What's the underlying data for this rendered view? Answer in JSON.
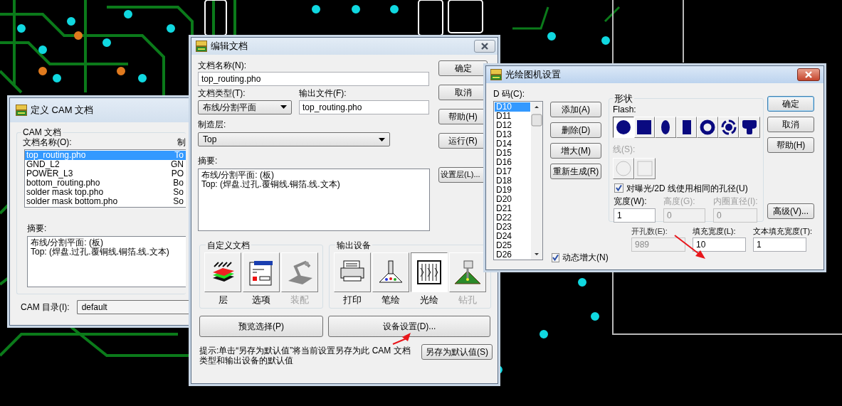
{
  "cam_window": {
    "title": "定义 CAM 文档",
    "group_label": "CAM 文档",
    "list_label": "文档名称(O):",
    "column_2_label": "制",
    "documents": [
      {
        "name": "top_routing.pho",
        "column_2": "To",
        "selected": true
      },
      {
        "name": "GND_L2",
        "column_2": "GN",
        "selected": false
      },
      {
        "name": "POWER_L3",
        "column_2": "PO",
        "selected": false
      },
      {
        "name": "bottom_routing.pho",
        "column_2": "Bo",
        "selected": false
      },
      {
        "name": "solder mask top.pho",
        "column_2": "So",
        "selected": false
      },
      {
        "name": "solder mask bottom.pho",
        "column_2": "So",
        "selected": false
      }
    ],
    "summary_label": "摘要:",
    "summary": [
      "布线/分割平面: (板)",
      "Top: (焊盘.过孔.覆铜线.铜箔.线.文本)"
    ],
    "directory_label": "CAM 目录(I):",
    "directory": "default"
  },
  "edit_window": {
    "title": "编辑文档",
    "name_label": "文档名称(N):",
    "name": "top_routing.pho",
    "type_label": "文档类型(T):",
    "type": "布线/分割平面",
    "output_label": "输出文件(F):",
    "output": "top_routing.pho",
    "layer_label": "制造层:",
    "layer": "Top",
    "summary_label": "摘要:",
    "summary": [
      "布线/分割平面: (板)",
      "Top: (焊盘.过孔.覆铜线.铜箔.线.文本)"
    ],
    "buttons": [
      "确定",
      "取消",
      "帮助(H)",
      "运行(R)",
      "设置层(L)..."
    ],
    "custom_group": "自定义文档",
    "custom_items": [
      {
        "kind": "layers",
        "label": "层",
        "disabled": false
      },
      {
        "kind": "options",
        "label": "选项",
        "disabled": false
      },
      {
        "kind": "assembly",
        "label": "装配",
        "disabled": true
      }
    ],
    "output_group": "输出设备",
    "output_devices": [
      {
        "kind": "print",
        "label": "打印",
        "disabled": false,
        "selected": false
      },
      {
        "kind": "pen",
        "label": "笔绘",
        "disabled": false,
        "selected": false
      },
      {
        "label": "光绘",
        "disabled": false,
        "selected": true
      },
      {
        "kind": "drill",
        "label": "钻孔",
        "disabled": true,
        "selected": false
      }
    ],
    "preview_button": "预览选择(P)",
    "device_button": "设备设置(D)...",
    "hint": "提示:单击“另存为默认值”将当前设置另存为此 CAM 文档类型和输出设备的默认值",
    "save_default_button": "另存为默认值(S)"
  },
  "photo_window": {
    "title": "光绘图机设置",
    "dcode_label": "D 码(C):",
    "dcodes": [
      {
        "code": "D10",
        "selected": true
      },
      {
        "code": "D11",
        "selected": false
      },
      {
        "code": "D12",
        "selected": false
      },
      {
        "code": "D13",
        "selected": false
      },
      {
        "code": "D14",
        "selected": false
      },
      {
        "code": "D15",
        "selected": false
      },
      {
        "code": "D16",
        "selected": false
      },
      {
        "code": "D17",
        "selected": false
      },
      {
        "code": "D18",
        "selected": false
      },
      {
        "code": "D19",
        "selected": false
      },
      {
        "code": "D20",
        "selected": false
      },
      {
        "code": "D21",
        "selected": false
      },
      {
        "code": "D22",
        "selected": false
      },
      {
        "code": "D23",
        "selected": false
      },
      {
        "code": "D24",
        "selected": false
      },
      {
        "code": "D25",
        "selected": false
      },
      {
        "code": "D26",
        "selected": false
      }
    ],
    "list_buttons": [
      "添加(A)",
      "删除(D)",
      "增大(M)",
      "重新生成(R)"
    ],
    "dynamic_grow": {
      "label": "动态增大(N)",
      "checked": true
    },
    "shape_group": "形状",
    "flash_label": "Flash:",
    "flash_shapes": [
      {
        "kind": "round",
        "selected": true
      },
      {
        "kind": "square",
        "selected": false
      },
      {
        "kind": "oval",
        "selected": false
      },
      {
        "kind": "rectangle",
        "selected": false
      },
      {
        "kind": "annular",
        "selected": false
      },
      {
        "kind": "thermal",
        "selected": false
      },
      {
        "kind": "odd",
        "selected": false
      }
    ],
    "line_label": "线(S):",
    "line_disabled": true,
    "line_shapes": [
      {
        "kind": "round"
      },
      {
        "kind": "square"
      }
    ],
    "same_aperture": {
      "label": "对曝光/2D 线使用相同的孔径(U)",
      "checked": true
    },
    "shape_fields": [
      {
        "label": "宽度(W):",
        "value": "1",
        "disabled": false
      },
      {
        "label": "高度(G):",
        "value": "0",
        "disabled": true
      },
      {
        "label": "内圈直径(I):",
        "value": "0",
        "disabled": true
      }
    ],
    "bottom_fields": [
      {
        "label": "开孔数(E):",
        "value": "989",
        "disabled": true
      },
      {
        "label": "填充宽度(L):",
        "value": "10",
        "disabled": false
      },
      {
        "label": "文本填充宽度(T):",
        "value": "1",
        "disabled": false
      }
    ],
    "buttons": [
      "确定",
      "取消",
      "帮助(H)"
    ],
    "advanced_button": "高级(V)..."
  }
}
